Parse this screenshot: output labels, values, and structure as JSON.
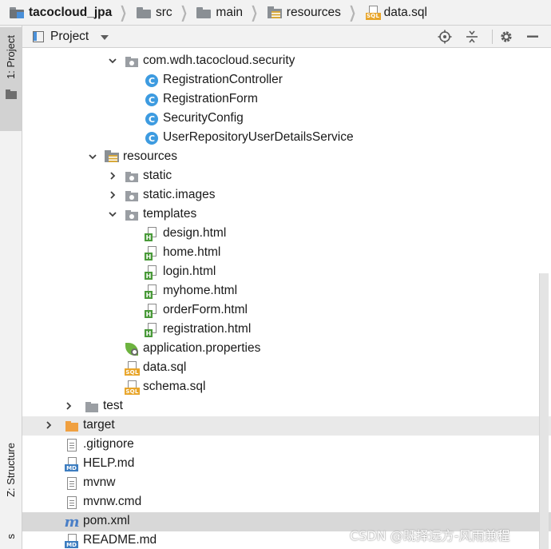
{
  "breadcrumb": [
    {
      "label": "tacocloud_jpa",
      "icon": "project-folder-icon"
    },
    {
      "label": "src",
      "icon": "folder-icon"
    },
    {
      "label": "main",
      "icon": "folder-icon"
    },
    {
      "label": "resources",
      "icon": "resources-folder-icon"
    },
    {
      "label": "data.sql",
      "icon": "sql-file-icon"
    }
  ],
  "tool_strip": {
    "project_tab": "1: Project",
    "structure_tab": "Z: Structure",
    "bottom_tab_fragment": "s"
  },
  "project_panel": {
    "title": "Project",
    "tools": [
      "locate-icon",
      "collapse-all-icon",
      "gear-icon",
      "hide-icon"
    ]
  },
  "tree": [
    {
      "label": "com.wdh.tacocloud.security",
      "type": "package",
      "expanded": true
    },
    {
      "label": "RegistrationController",
      "type": "class"
    },
    {
      "label": "RegistrationForm",
      "type": "class"
    },
    {
      "label": "SecurityConfig",
      "type": "class"
    },
    {
      "label": "UserRepositoryUserDetailsService",
      "type": "class"
    },
    {
      "label": "resources",
      "type": "resources-folder",
      "expanded": true
    },
    {
      "label": "static",
      "type": "package",
      "expanded": false
    },
    {
      "label": "static.images",
      "type": "package",
      "expanded": false
    },
    {
      "label": "templates",
      "type": "package",
      "expanded": true
    },
    {
      "label": "design.html",
      "type": "html"
    },
    {
      "label": "home.html",
      "type": "html"
    },
    {
      "label": "login.html",
      "type": "html"
    },
    {
      "label": "myhome.html",
      "type": "html"
    },
    {
      "label": "orderForm.html",
      "type": "html"
    },
    {
      "label": "registration.html",
      "type": "html"
    },
    {
      "label": "application.properties",
      "type": "spring-properties"
    },
    {
      "label": "data.sql",
      "type": "sql"
    },
    {
      "label": "schema.sql",
      "type": "sql"
    },
    {
      "label": "test",
      "type": "folder",
      "expanded": false
    },
    {
      "label": "target",
      "type": "excluded-folder",
      "expanded": false
    },
    {
      "label": ".gitignore",
      "type": "text-file"
    },
    {
      "label": "HELP.md",
      "type": "markdown"
    },
    {
      "label": "mvnw",
      "type": "text-file"
    },
    {
      "label": "mvnw.cmd",
      "type": "text-file"
    },
    {
      "label": "pom.xml",
      "type": "maven"
    },
    {
      "label": "README.md",
      "type": "markdown"
    }
  ],
  "icons": {
    "class_letter": "C",
    "html_letter": "H",
    "sql_badge": "SQL",
    "md_badge": "MD",
    "maven_letter": "m"
  },
  "watermark": "CSDN @既择远方-风雨兼程",
  "colors": {
    "class_icon": "#3d9be0",
    "html_badge": "#4a9a3a",
    "sql_badge": "#e8a52a",
    "excluded_folder": "#f0a040",
    "selection": "#d8d8d8"
  }
}
